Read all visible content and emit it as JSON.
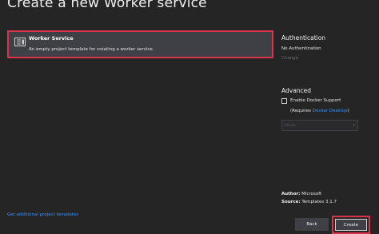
{
  "window": {
    "title": "Create a new Worker service"
  },
  "template": {
    "icon": "worker-service-icon",
    "name": "Worker Service",
    "description": "An empty project template for creating a worker service."
  },
  "footer": {
    "additional_templates_link": "Get additional project templates"
  },
  "authentication": {
    "heading": "Authentication",
    "value": "No Authentication",
    "change_label": "Change"
  },
  "advanced": {
    "heading": "Advanced",
    "docker_checkbox_label": "Enable Docker Support",
    "docker_checked": false,
    "requires_prefix": "(Requires ",
    "requires_link": "Docker Desktop",
    "requires_suffix": ")",
    "os_select_value": "Linux"
  },
  "meta": {
    "author_label": "Author:",
    "author_value": "Microsoft",
    "source_label": "Source:",
    "source_value": "Templates 3.1.7"
  },
  "buttons": {
    "back": "Back",
    "create": "Create"
  },
  "colors": {
    "background": "#252526",
    "selected_item": "#3f3f46",
    "highlight_border": "#d9344a",
    "link": "#3794ff"
  }
}
